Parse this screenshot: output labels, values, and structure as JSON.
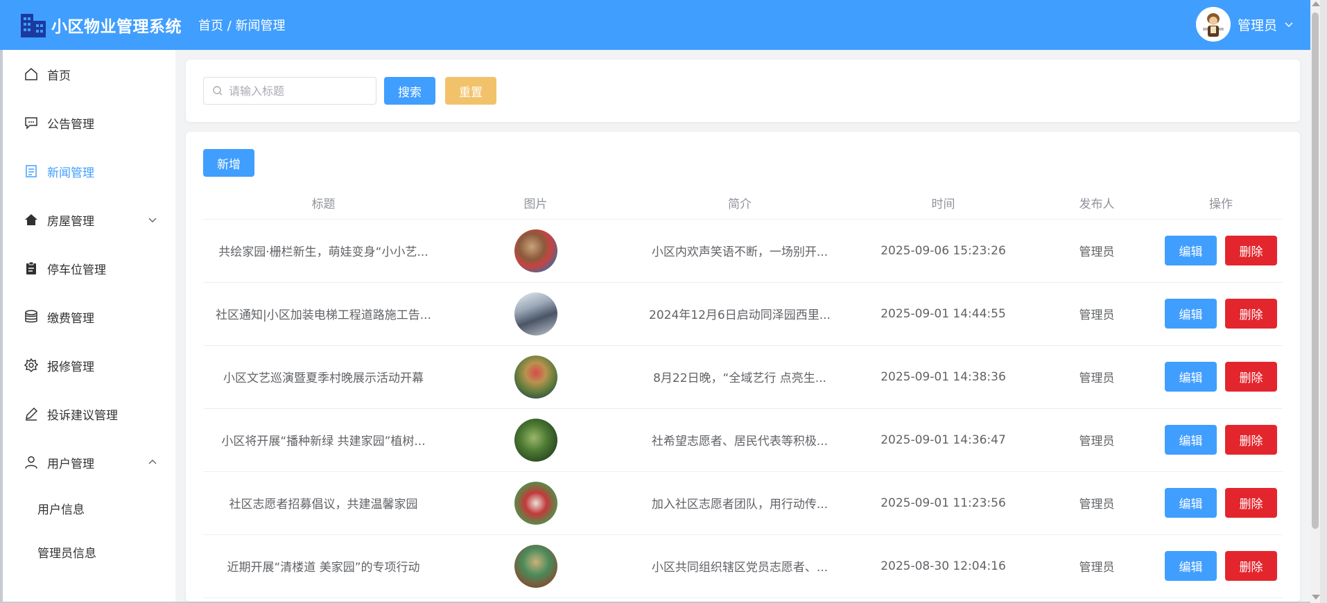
{
  "app": {
    "title": "小区物业管理系统",
    "breadcrumb": "首页 / 新闻管理",
    "user_name": "管理员"
  },
  "sidebar": {
    "items": [
      {
        "label": "首页",
        "icon": "home-icon"
      },
      {
        "label": "公告管理",
        "icon": "chat-icon"
      },
      {
        "label": "新闻管理",
        "icon": "document-icon",
        "active": true
      },
      {
        "label": "房屋管理",
        "icon": "house-icon",
        "expandable": true,
        "expanded": false
      },
      {
        "label": "停车位管理",
        "icon": "clipboard-icon"
      },
      {
        "label": "缴费管理",
        "icon": "coins-icon"
      },
      {
        "label": "报修管理",
        "icon": "gear-icon"
      },
      {
        "label": "投诉建议管理",
        "icon": "pen-icon"
      },
      {
        "label": "用户管理",
        "icon": "user-icon",
        "expandable": true,
        "expanded": true
      }
    ],
    "sub_items": [
      "用户信息",
      "管理员信息"
    ]
  },
  "search": {
    "placeholder": "请输入标题",
    "search_label": "搜索",
    "reset_label": "重置"
  },
  "toolbar": {
    "add_label": "新增"
  },
  "table": {
    "columns": [
      "标题",
      "图片",
      "简介",
      "时间",
      "发布人",
      "操作"
    ],
    "edit_label": "编辑",
    "delete_label": "删除",
    "rows": [
      {
        "title": "共绘家园·栅栏新生，萌娃变身“小小艺...",
        "summary": "小区内欢声笑语不断，一场别开...",
        "time": "2025-09-06 15:23:26",
        "author": "管理员"
      },
      {
        "title": "社区通知|小区加装电梯工程道路施工告...",
        "summary": "2024年12月6日启动同泽园西里...",
        "time": "2025-09-01 14:44:55",
        "author": "管理员"
      },
      {
        "title": "小区文艺巡演暨夏季村晚展示活动开幕",
        "summary": "8月22日晚，“全域艺行 点亮生...",
        "time": "2025-09-01 14:38:36",
        "author": "管理员"
      },
      {
        "title": "小区将开展“播种新绿 共建家园”植树...",
        "summary": "社希望志愿者、居民代表等积极...",
        "time": "2025-09-01 14:36:47",
        "author": "管理员"
      },
      {
        "title": "社区志愿者招募倡议，共建温馨家园",
        "summary": "加入社区志愿者团队，用行动传...",
        "time": "2025-09-01 11:23:56",
        "author": "管理员"
      },
      {
        "title": "近期开展“清楼道 美家园”的专项行动",
        "summary": "小区共同组织辖区党员志愿者、...",
        "time": "2025-08-30 12:04:16",
        "author": "管理员"
      }
    ]
  },
  "colors": {
    "primary": "#409eff",
    "warning": "#f2c26b",
    "danger": "#e3262d"
  }
}
